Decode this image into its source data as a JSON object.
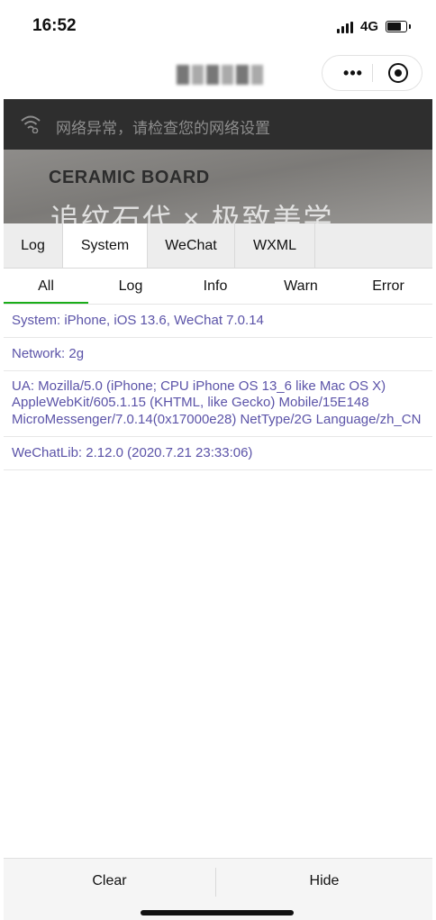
{
  "status_bar": {
    "time": "16:52",
    "network": "4G"
  },
  "banner": {
    "network_error": "网络异常，请检查您的网络设置",
    "brand_text": "CERAMIC BOARD",
    "slogan": "追纹石代 × 极致美学"
  },
  "console": {
    "tabs": [
      "Log",
      "System",
      "WeChat",
      "WXML"
    ],
    "active_tab": "System",
    "filters": [
      "All",
      "Log",
      "Info",
      "Warn",
      "Error"
    ],
    "active_filter": "All",
    "entries": [
      "System: iPhone, iOS 13.6, WeChat 7.0.14",
      "Network: 2g",
      "UA: Mozilla/5.0 (iPhone; CPU iPhone OS 13_6 like Mac OS X) AppleWebKit/605.1.15 (KHTML, like Gecko) Mobile/15E148 MicroMessenger/7.0.14(0x17000e28) NetType/2G Language/zh_CN",
      "WeChatLib: 2.12.0 (2020.7.21 23:33:06)"
    ],
    "clear_label": "Clear",
    "hide_label": "Hide"
  },
  "colors": {
    "log_text": "#5b53a8",
    "active_underline": "#1aad19"
  },
  "icons": {
    "wifi": "wifi-icon",
    "more": "more-dots-icon",
    "close": "target-circle-icon"
  }
}
